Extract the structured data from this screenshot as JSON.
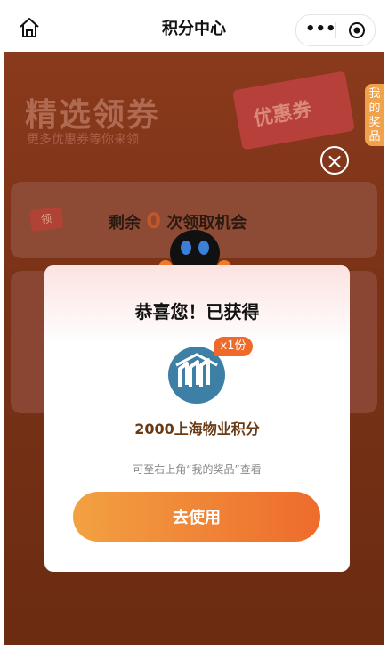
{
  "nav": {
    "title": "积分中心",
    "more_glyph": "•••"
  },
  "background": {
    "banner_title": "精选领券",
    "banner_subtitle": "更多优惠券等你来领",
    "coupon_text": "优惠券",
    "prize_tab": "我的奖品",
    "close_glyph": "×",
    "remain_prefix": "剩余",
    "remain_count": "0",
    "remain_suffix": "次领取机会",
    "tag_text": "领"
  },
  "modal": {
    "heading": "恭喜您！已获得",
    "quantity_badge": "x1份",
    "prize_name": "2000上海物业积分",
    "hint": "可至右上角“我的奖品”查看",
    "button_label": "去使用"
  },
  "colors": {
    "accent": "#ee6b2c",
    "background": "#7a3217",
    "logo": "#3d7fa5"
  }
}
